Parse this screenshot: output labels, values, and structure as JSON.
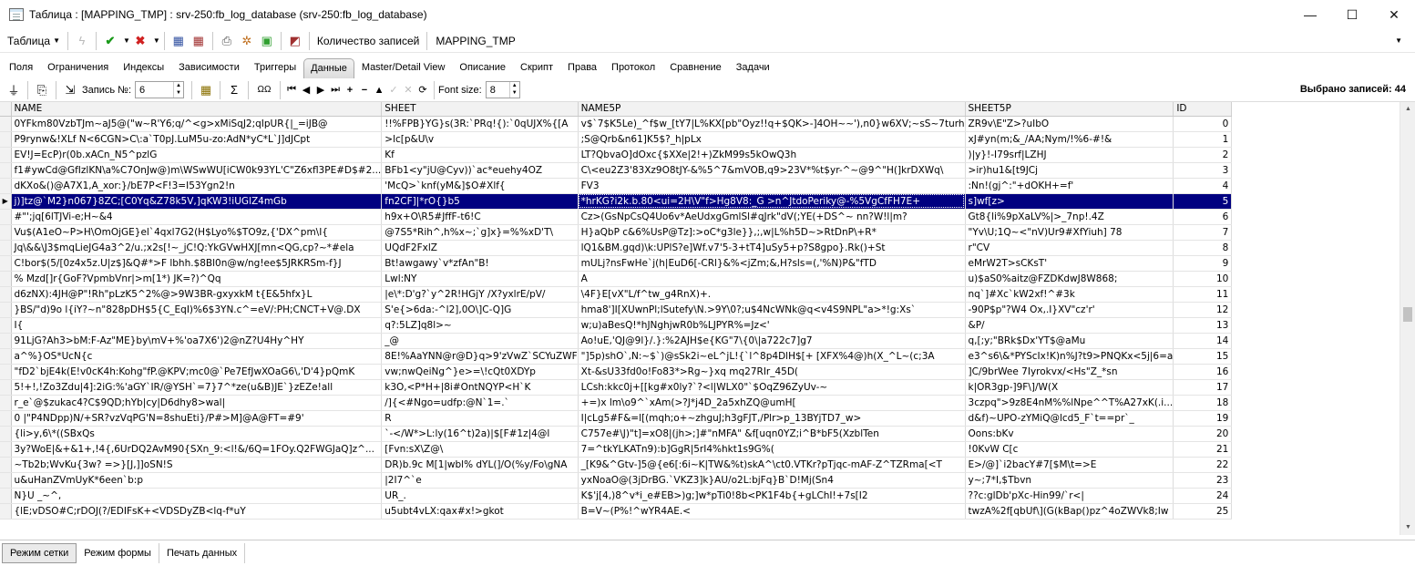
{
  "window": {
    "title": "Таблица : [MAPPING_TMP] : srv-250:fb_log_database (srv-250:fb_log_database)",
    "minimize": "—",
    "maximize": "☐",
    "close": "✕"
  },
  "toolbar1": {
    "table_menu": "Таблица",
    "record_count_label": "Количество записей",
    "table_name": "MAPPING_TMP"
  },
  "tabs": [
    {
      "label": "Поля"
    },
    {
      "label": "Ограничения"
    },
    {
      "label": "Индексы"
    },
    {
      "label": "Зависимости"
    },
    {
      "label": "Триггеры"
    },
    {
      "label": "Данные"
    },
    {
      "label": "Master/Detail View"
    },
    {
      "label": "Описание"
    },
    {
      "label": "Скрипт"
    },
    {
      "label": "Права"
    },
    {
      "label": "Протокол"
    },
    {
      "label": "Сравнение"
    },
    {
      "label": "Задачи"
    }
  ],
  "toolbar2": {
    "record_label": "Запись №:",
    "record_value": "6",
    "sum_label": "Σ",
    "ab_label": "ΩΩ",
    "font_size_label": "Font size:",
    "font_size_value": "8",
    "selected_label": "Выбрано записей: 44"
  },
  "grid": {
    "columns": [
      "NAME",
      "SHEET",
      "NAME5P",
      "SHEET5P",
      "ID"
    ],
    "selected_index": 5,
    "rows": [
      [
        "0YFkm80VzbTJm~aJ5@(\"w~R'Y6;q/^<g>xMiSqJ2;qIpUR{|_=iJB@",
        "!!%FPB}YG}s(3R:`PRq!{):`0qUJX%{[A",
        "v$`7$K5Le)_^f$w_[tY7|L%KX[pb\"Oyz!!q+$QK>-]4OH~~'),n0}w6XV;~sS~7turh",
        "ZR9v\\E\"Z>?uIbO",
        "0"
      ],
      [
        "P9rynw&!XLf N<6CGN>C\\:a`T0pJ.LuM5u-zo:AdN*yC*L`J]dJCpt",
        ">lc[p&U\\v",
        ";S@Qrb&n61]K5$?_h|pLx",
        "xJ#yn(m;&_/AA;Nym/!%6-#!&",
        "1"
      ],
      [
        "EV!J=EcP)r(0b.xACn_N5^pzlG",
        "Kf",
        "LT?QbvaO]dOxc{$XXe|2!+)ZkM99s5kOwQ3h",
        ")|y}!-I79srf|LZHJ",
        "2"
      ],
      [
        "f1#ywCd@GfIzlKN\\a%C7OnJw@)m\\WSwWU[iCW0k93YL'C\"Z6xfl3PE#D$#2...",
        "BFb1<y\"jU@Cyv))`ac*euehy4OZ",
        "C\\<eu2Z3'83Xz9O8tJY-&%5^7&mVOB,q9>23V*%t$yr-^~@9^\"H(]krDXWq\\",
        ">ir)hu1&[t9JCj",
        "3"
      ],
      [
        "dKXo&()@A7X1,A_xor:}/bE7P<F!3=I53Ygn2!n",
        "'McQ>`knf(yM&]$O#Xlf{",
        "FV3",
        ":Nn!(gj^:\"+dOKH+=f'",
        "4"
      ],
      [
        "j)]tz@`M2}n067}8ZC;[C0Yq&Z78k5V,]qKW3!iUGlZ4mGb",
        "fn2CF]|*rO{}b5",
        "*hrKG?i2k.b.80<ui=2H\\V\"f>Hg8V8:_G >n^JtdoPeriky@-%5VgCfFH7E+",
        "s]wf[z>",
        "5"
      ],
      [
        "#\"';jq[6lTJVi-e;H~&4",
        "h9x+O\\R5#JffF-t6!C",
        "Cz>(GsNpCsQ4Uo6v*AeUdxgGmlSl#qJrk\"dV(;YE(+DS^~ nn?W!l|m?",
        "Gt8{li%9pXaLV%|>_7np!.4Z",
        "6"
      ],
      [
        "Vu$(A1eO~P>H\\OmOjGE}el`4qxl7G2(H$Lyo%$TO9z,{'DX^pm\\I{",
        "@7S5*Rih^,h%x~;`g]x}=%%xD'T\\",
        "H}aQbP c&6%UsP@Tz]:>oC*g3le}},;,w|L%h5D~>RtDnP\\+R*",
        "\"Yv\\U;1Q~<\"nV)Ur9#XfYiuh] 78",
        "7"
      ],
      [
        "Jq\\&&\\J3$mqLieJG4a3^2/u.;x2s[!~_jC!Q:YkGVwHXJ[mn<QG,cp?~*#ela",
        "UQdF2FxlZ",
        "lQ1&BM.gqd)\\k:UPlS?e]Wf.v7'5-3+tT4]uSy5+p?S8gpo}.Rk()+St",
        "r\"CV",
        "8"
      ],
      [
        "C!bor$(5/[0z4x5z.U|z$]&Q#*>F lbhh.$8Bl0n@w/ng!ee$5JRKRSm-f}J",
        "Bt!awgawy`v*zfAn\"B!",
        "mULj?nsFwHe`j(h|EuD6[-CRl}&%<jZm;&,H?sls=(,'%N)P&\"fTD",
        "eMrW2T>sCKsT'",
        "9"
      ],
      [
        "% Mzd[]r{GoF?VpmbVnr|>m[1*) JK=?)^Qq",
        "Lwl:NY",
        "A",
        "u)$aS0%aitz@FZDKdwJ8W868;",
        "10"
      ],
      [
        "d6zNX):4JH@P\"!Rh\"pLzK5^2%@>9W3BR-gxyxkM t{E&5hfx}L",
        "|e\\*:D'g?`y^2R!HGjY /X?yxlrE/pV/",
        "\\4F}E[vX\"L/f^tw_g4RnX)+.",
        "nq`]#Xc`kW2xf!^#3k",
        "11"
      ],
      [
        "}BS/\"d)9o l{iY?~n\"828pDH$5{C_EqI)%6$3YN.c^=eV/:PH;CNCT+V@.DX",
        "S'e{>6da:-^l2],0O\\]C-Q]G",
        "hma8']I[XUwnPl;lSutefy\\N.>9Y\\0?;u$4NcWNk@q<v4S9NPL\"a>*!g:Xs`",
        "-90P$p\"?W4 Ox,.I}XV\"cz'r'",
        "12"
      ],
      [
        "I{",
        "q?:5LZ]q8l>~",
        "w;u)aBesQ!*hJNghjwR0b%LJPYR%=Jz<'",
        "&P/",
        "13"
      ],
      [
        "91LjG?Ah3>bM:F-Az\"ME}by\\mV+%'oa7X6')2@nZ?U4Hy^HY",
        "_@",
        "Ao!uE,'QJ@9l}/.}:%2AJH$e{KG\"7\\{0\\|a722c7]g7",
        "q,[;y;\"BRk$Dx'YT$@aMu",
        "14"
      ],
      [
        "a^%}OS*UcN{c",
        "8E!%AaYNN@r@D}q>9'zVwZ`SCYuZWF",
        "\"]5p)shO`,N:~$`)@sSk2i~eL^jL!{`l^8p4DlH$[+ [XFX%4@)h(X_^L~(c;3A",
        "e3^s6\\&*PYScIx!K)n%J?t9>PNQKx<5j|6=a",
        "15"
      ],
      [
        "\"fD2`bjE4k(E!v0cK4h:Kohg\"fP.@KPV;mc0@`Pe7EfJwXOaG6\\,'D'4}pQmK",
        "vw;nwQeiNg^}e>=\\!cQt0XDYp",
        "Xt-&sU33fd0o!Fo83*>Rg~}xq mq27RIr_45D(",
        "]C/9brWee 7Iyrokvx/<Hs\"Z_*sn",
        "16"
      ],
      [
        "5!+!,!Zo3Zdu|4]:2iG:%'aGY`IR/@YSH`=7}7^*ze(u&B)JE`}zEZe!all",
        "k3O,<P*H+|8i#OntNQYP<H`K",
        "LCsh:kkc0j+[[kg#x0ly?`?<l|WLX0\"`$OqZ96ZyUv-~",
        "k|OR3gp-]9F\\]/W(X",
        "17"
      ],
      [
        "r_e`@$zukac4?C$9QD;hYb|cy|D6dhy8>wal|",
        "/]{<#Ngo=udfp:@N`1=.`",
        "+=)x lm\\o9^`xAm(>?J*j4D_2a5xhZQ@umH[",
        "3czpq\">9z8E4nM%%lNpe^^T%A27xK(.i...",
        "18"
      ],
      [
        "0 |\"P4NDpp)N/+SR?vzVqPG'N=8shuEti}/P#>M]@A@FT=#9'",
        "R",
        "I|cLg5#F&=l[(mqh;o+~zhguJ;h3gFJT,/Plr>p_13BYjTD7_w>",
        "d&f)~UPO-zYMiQ@lcd5_F`t==pr`_",
        "19"
      ],
      [
        "{li>y,6\\*((SBxQs",
        "`-</W*>L:ly(16^t)2a)|$[F#1z|4@l",
        "C757e#\\J)\"t]=xO8|(jh>;]#\"nMFA\" &f[uqn0YZ;i^B*bF5(XzblTen",
        "Oons:bKv",
        "20"
      ],
      [
        "3y?WoE|&+&1+,!4{,6UrDQ2AvM90{SXn_9:<l!&/6Q=1FOy.Q2FWGJaQ]z^...",
        "[Fvn:sX\\Z@\\",
        "7=^tkYLKATn9):b]GgR|5rI4%hkt1s9G%(",
        "!0KvW C[c",
        "21"
      ],
      [
        "~Tb2b;WvKu{3w? =>}[J,]]oSN!S",
        "DR)b.9c M[1|wbl% dYL(]/O(%y/Fo\\gNA",
        "_[K9&^Gtv-]5@{e6[:6i~K|TW&%t)skA^\\ct0.VTKr?pTjqc-mAF-Z^TZRma[<T",
        "E>/@]`i2bacY#7[$M\\t=>E",
        "22"
      ],
      [
        "u&uHanZVmUyK*6een`b:p",
        "|2I7^`e",
        "yxNoaO@(3jDrBG.`VKZ3]k}AU/o2L:bjFq}B`D!Mj(Sn4",
        "y~;7*I,$Tbvn",
        "23"
      ],
      [
        "N}U _~^,",
        "UR_.",
        "K$'j[4,)8^v*i_e#EB>)g;]w*pTi0!8b<PK1F4b{+gLChI!+7s[I2",
        "??c:glDb'pXc-Hin99/`r<|",
        "24"
      ],
      [
        "{lE;vDSO#C;rDOJ(?/EDIFsK+<VDSDyZB<lq-f*uY",
        "u5ubt4vLX:qax#x!>gkot",
        "B=V~(P%!^wYR4AE.<",
        "twzA%2f[qbUf\\](G(kBap()pz^4oZWVk8;Iw",
        "25"
      ]
    ]
  },
  "bottom_tabs": [
    {
      "label": "Режим сетки"
    },
    {
      "label": "Режим формы"
    },
    {
      "label": "Печать данных"
    }
  ]
}
